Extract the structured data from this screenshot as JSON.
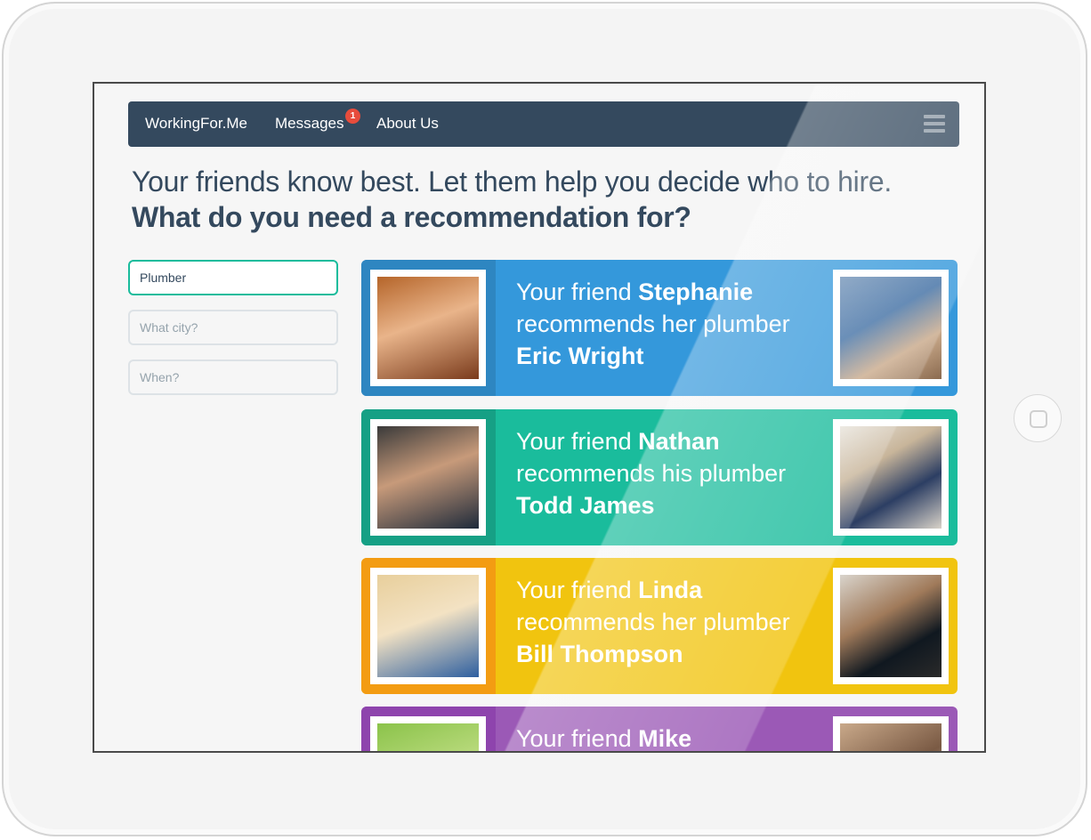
{
  "nav": {
    "brand": "WorkingFor.Me",
    "messages_label": "Messages",
    "messages_badge": "1",
    "about_label": "About Us",
    "menu_icon": "hamburger-menu-icon",
    "bg_color": "#34495e"
  },
  "hero": {
    "headline": "Your friends know best. Let them help you decide who to hire.",
    "subheadline": "What do you need a recommendation for?"
  },
  "search": {
    "service_value": "Plumber",
    "city_placeholder": "What city?",
    "when_placeholder": "When?"
  },
  "recommendations": [
    {
      "prefix": "Your friend",
      "friend": "Stephanie",
      "middle": "recommends her plumber",
      "pro": "Eric Wright",
      "color": "#3498db",
      "accent": "#2e86c1"
    },
    {
      "prefix": "Your friend",
      "friend": "Nathan",
      "middle": "recommends his plumber",
      "pro": "Todd James",
      "color": "#1abc9c",
      "accent": "#16a085"
    },
    {
      "prefix": "Your friend",
      "friend": "Linda",
      "middle": "recommends her plumber",
      "pro": "Bill Thompson",
      "color": "#f1c40f",
      "accent": "#f39c12"
    },
    {
      "prefix": "Your friend",
      "friend": "Mike",
      "middle": "",
      "pro": "",
      "color": "#9b59b6",
      "accent": "#8e44ad"
    }
  ]
}
